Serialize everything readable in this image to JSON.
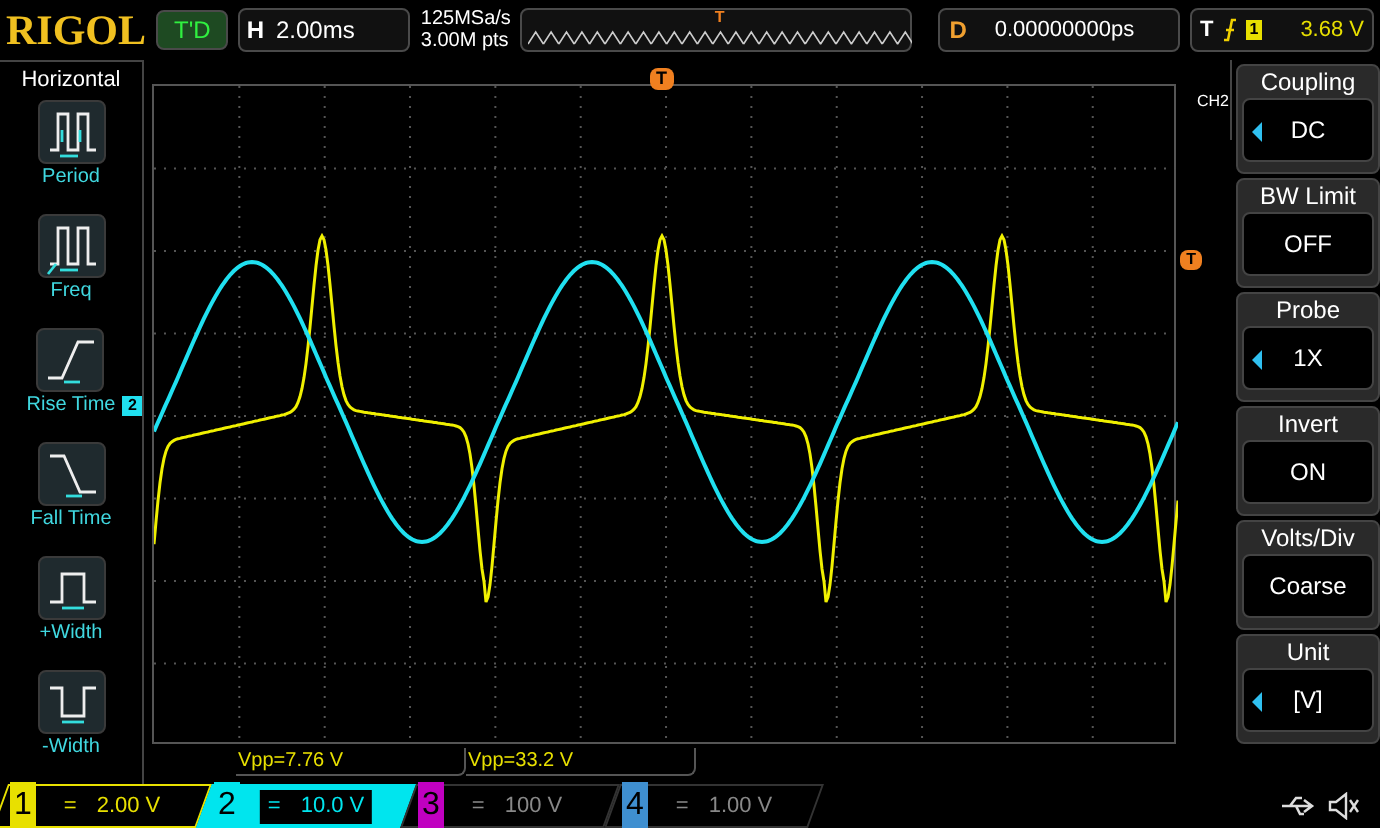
{
  "top_bar": {
    "logo": "RIGOL",
    "run_status": "T'D",
    "timebase": {
      "label": "H",
      "value": "2.00ms"
    },
    "sample_rate": "125MSa/s",
    "memory_depth": "3.00M pts",
    "trigger_marker": "T",
    "delay": {
      "label": "D",
      "value": "0.00000000ps"
    },
    "trigger": {
      "label": "T",
      "source": "1",
      "level": "3.68 V"
    }
  },
  "left_menu": {
    "title": "Horizontal",
    "items": [
      {
        "kind": "period",
        "label": "Period"
      },
      {
        "kind": "freq",
        "label": "Freq"
      },
      {
        "kind": "rise",
        "label": "Rise Time"
      },
      {
        "kind": "fall",
        "label": "Fall Time"
      },
      {
        "kind": "pwidth",
        "label": "+Width"
      },
      {
        "kind": "nwidth",
        "label": "-Width"
      }
    ]
  },
  "grid": {
    "top_trigger_marker": "T",
    "right_trigger_marker": "T",
    "channel_marker": "2"
  },
  "measurements": [
    "Vpp=7.76 V",
    "Vpp=33.2 V"
  ],
  "right_menu": {
    "channel": "CH2",
    "items": [
      {
        "title": "Coupling",
        "value": "DC",
        "adjustable": true
      },
      {
        "title": "BW Limit",
        "value": "OFF",
        "adjustable": false
      },
      {
        "title": "Probe",
        "value": "1X",
        "adjustable": true
      },
      {
        "title": "Invert",
        "value": "ON",
        "adjustable": false
      },
      {
        "title": "Volts/Div",
        "value": "Coarse",
        "adjustable": false
      },
      {
        "title": "Unit",
        "value": "[V]",
        "adjustable": true
      }
    ]
  },
  "channels": [
    {
      "number": "1",
      "coupling": "=",
      "scale": "2.00 V",
      "selected": false,
      "color": "#e8e000",
      "enabled": true
    },
    {
      "number": "2",
      "coupling": "=",
      "scale": "10.0 V",
      "selected": true,
      "color": "#00e5ee",
      "enabled": true
    },
    {
      "number": "3",
      "coupling": "=",
      "scale": "100 V",
      "selected": false,
      "color": "#c000c0",
      "enabled": false
    },
    {
      "number": "4",
      "coupling": "=",
      "scale": "1.00 V",
      "selected": false,
      "color": "#3f8fd0",
      "enabled": false
    }
  ]
}
